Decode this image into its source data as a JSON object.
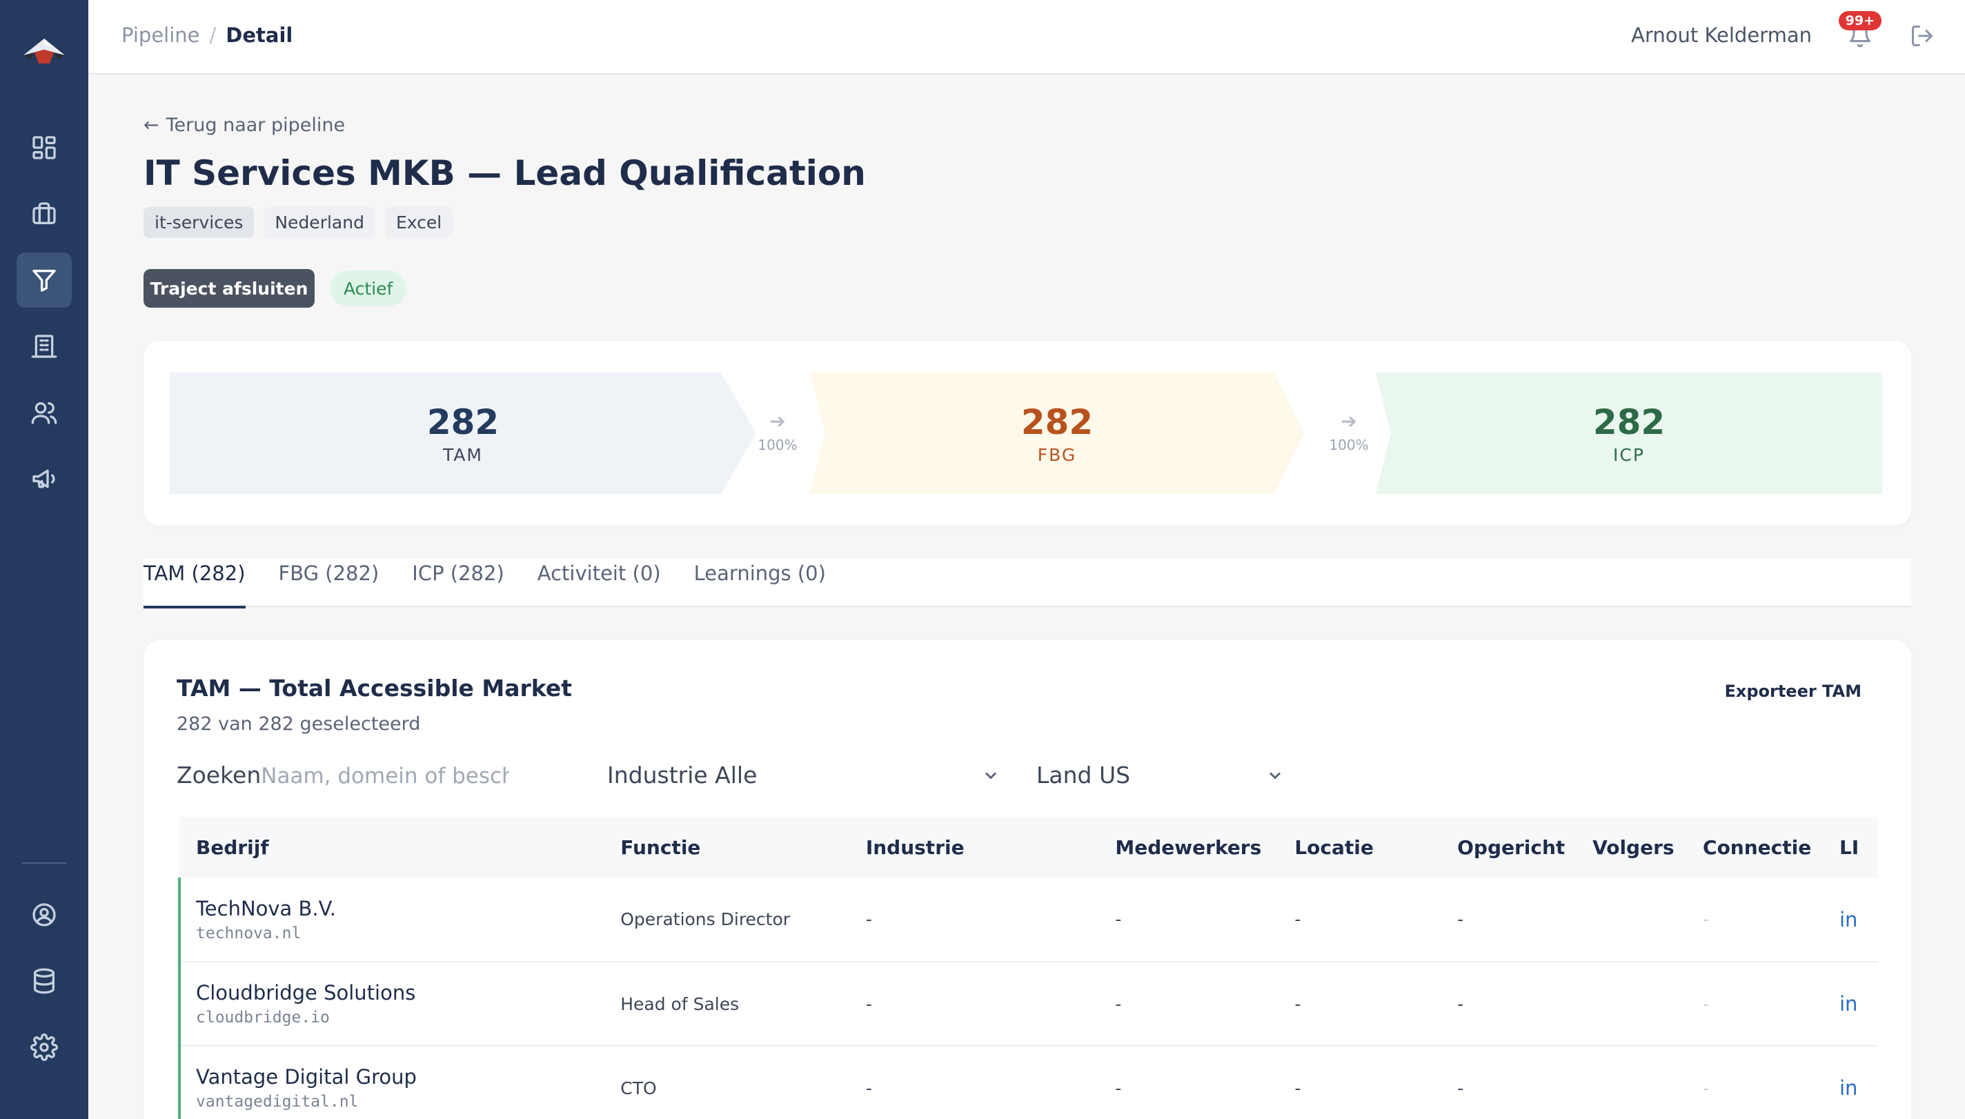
{
  "topbar": {
    "breadcrumb": [
      "Pipeline",
      "Detail"
    ],
    "separator": "/",
    "user_name": "Arnout Kelderman",
    "notification_badge": "99+"
  },
  "sidebar": {
    "items": [
      {
        "icon": "dashboard-icon"
      },
      {
        "icon": "briefcase-icon"
      },
      {
        "icon": "filter-icon",
        "active": true
      },
      {
        "icon": "building-icon"
      },
      {
        "icon": "users-icon"
      },
      {
        "icon": "megaphone-icon"
      }
    ],
    "bottom_items": [
      {
        "icon": "user-circle-icon"
      },
      {
        "icon": "database-icon"
      },
      {
        "icon": "settings-icon"
      }
    ]
  },
  "header": {
    "back_label": "Terug naar pipeline",
    "title": "IT Services MKB — Lead Qualification",
    "tags": [
      "it-services",
      "Nederland",
      "Excel"
    ],
    "close_button": "Traject afsluiten",
    "status": "Actief"
  },
  "funnel": {
    "stages": [
      {
        "value": "282",
        "label": "TAM",
        "color": "#243a5e"
      },
      {
        "value": "282",
        "label": "FBG",
        "color": "#b7521f"
      },
      {
        "value": "282",
        "label": "ICP",
        "color": "#2e6a47"
      }
    ],
    "conversions": [
      "100%",
      "100%"
    ]
  },
  "tabs": [
    {
      "label": "TAM (282)",
      "active": true
    },
    {
      "label": "FBG (282)"
    },
    {
      "label": "ICP (282)"
    },
    {
      "label": "Activiteit (0)"
    },
    {
      "label": "Learnings (0)"
    }
  ],
  "tam": {
    "title": "TAM — Total Accessible Market",
    "subtitle": "282 van 282 geselecteerd",
    "export_label": "Exporteer TAM",
    "search_label": "Zoeken",
    "search_placeholder": "Naam, domein of beschrijving",
    "industry_filter": "Industrie Alle",
    "country_filter": "Land US",
    "columns": [
      "Bedrijf",
      "Functie",
      "Industrie",
      "Medewerkers",
      "Locatie",
      "Opgericht",
      "Volgers",
      "Connectie",
      "LI"
    ],
    "rows": [
      {
        "name": "TechNova B.V.",
        "domain": "technova.nl",
        "function": "Operations Director",
        "industry": "-",
        "employees": "-",
        "location": "-",
        "founded": "-",
        "followers": "",
        "connection": "-",
        "li": "in"
      },
      {
        "name": "Cloudbridge Solutions",
        "domain": "cloudbridge.io",
        "function": "Head of Sales",
        "industry": "-",
        "employees": "-",
        "location": "-",
        "founded": "-",
        "followers": "",
        "connection": "-",
        "li": "in"
      },
      {
        "name": "Vantage Digital Group",
        "domain": "vantagedigital.nl",
        "function": "CTO",
        "industry": "-",
        "employees": "-",
        "location": "-",
        "founded": "-",
        "followers": "",
        "connection": "-",
        "li": "in"
      }
    ]
  }
}
